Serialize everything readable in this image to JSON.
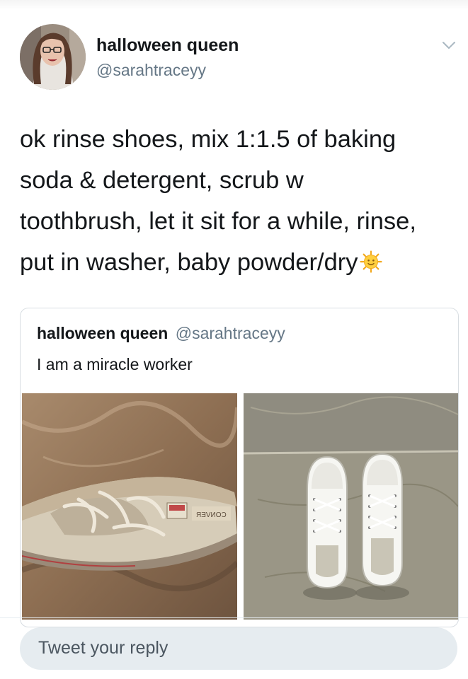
{
  "tweet": {
    "author": {
      "display_name": "halloween queen",
      "handle": "@sarahtraceyy",
      "avatar_icon": "profile-photo"
    },
    "text_lines": [
      "ok rinse shoes, mix 1:1.5 of baking",
      "soda & detergent, scrub w",
      "toothbrush, let it sit for a while, rinse,",
      "put in washer, baby powder/dry"
    ],
    "emoji": "sun-face-emoji",
    "menu_icon": "chevron-down-icon"
  },
  "quoted_tweet": {
    "display_name": "halloween queen",
    "handle": "@sarahtraceyy",
    "text": "I am a miracle worker",
    "media": [
      {
        "description": "dirty-sneaker-before"
      },
      {
        "description": "clean-white-sneakers-after"
      }
    ]
  },
  "reply": {
    "placeholder": "Tweet your reply"
  },
  "colors": {
    "text_primary": "#14171a",
    "text_secondary": "#657786",
    "reply_bg": "#e6ecf0",
    "border": "#d8dde2"
  }
}
